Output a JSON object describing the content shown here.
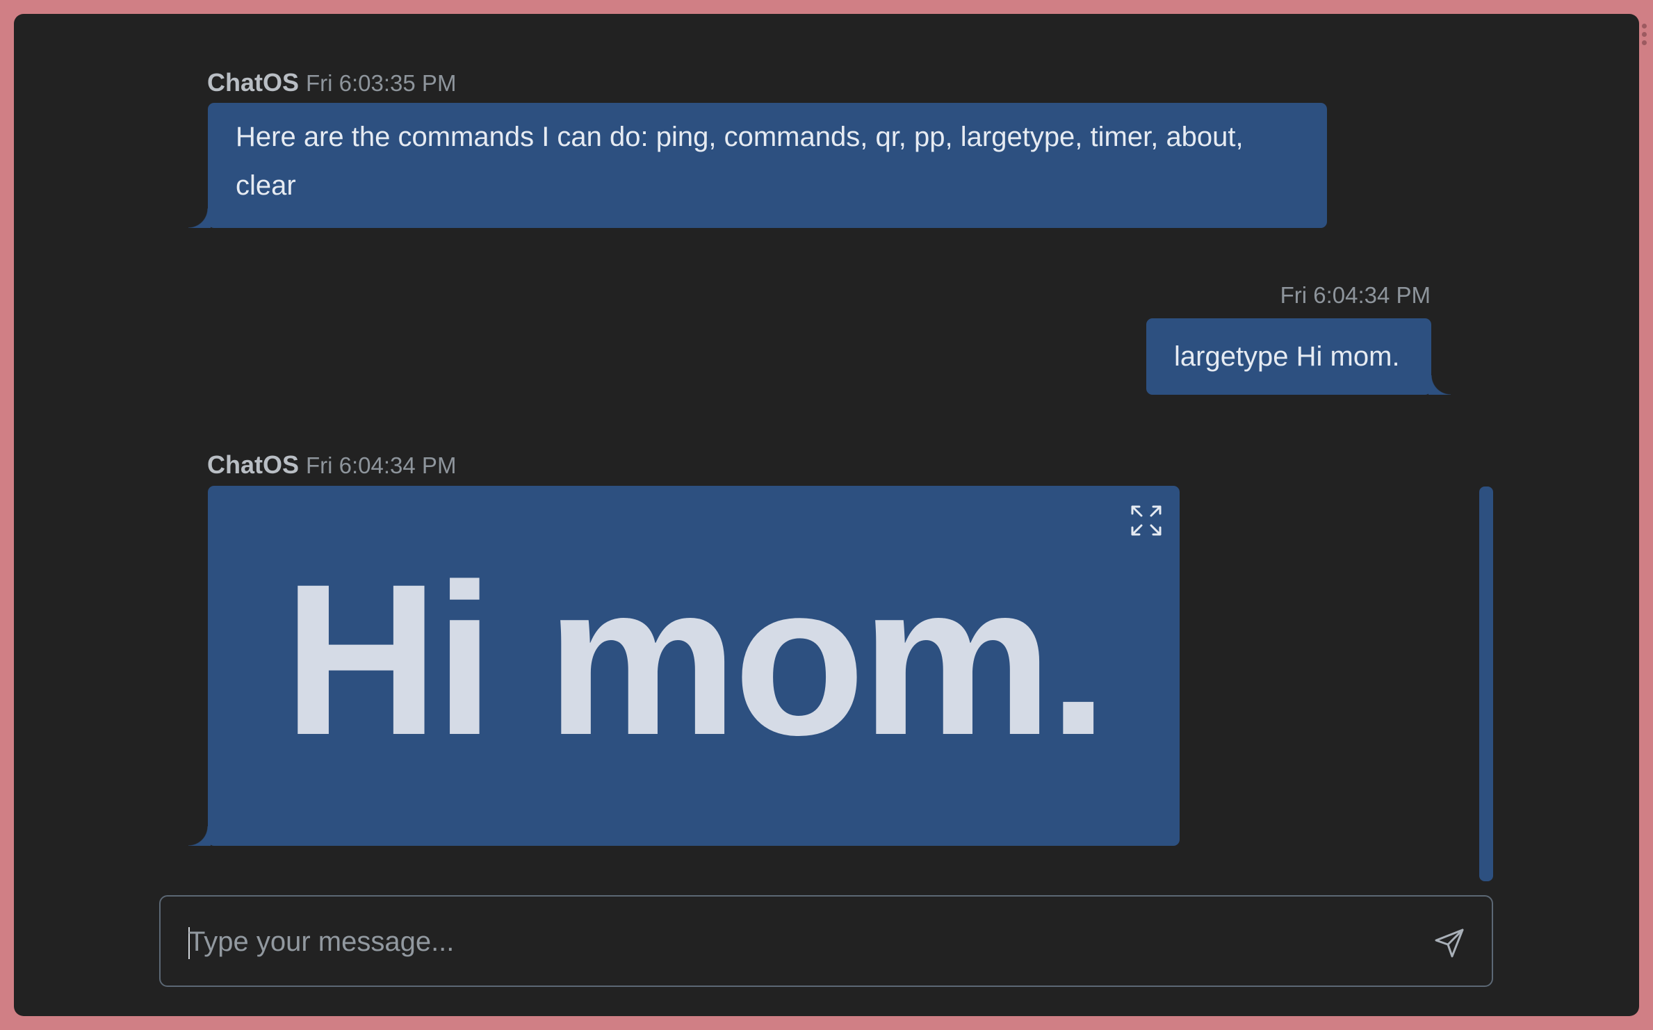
{
  "messages": [
    {
      "sender": "ChatOS",
      "time": "Fri 6:03:35 PM",
      "text": "Here are the commands I can do: ping, commands, qr, pp, largetype, timer, about, clear"
    },
    {
      "sender": "",
      "time": "Fri 6:04:34 PM",
      "text": "largetype Hi mom."
    },
    {
      "sender": "ChatOS",
      "time": "Fri 6:04:34 PM",
      "text": "Hi mom."
    }
  ],
  "icons": {
    "expand": "expand-arrows-icon",
    "send": "paper-plane-icon"
  },
  "composer": {
    "placeholder": "Type your message..."
  },
  "colors": {
    "frame": "#d07f85",
    "background": "#222222",
    "bubble": "#2d5080",
    "largetype_text": "#d5dbe6"
  }
}
